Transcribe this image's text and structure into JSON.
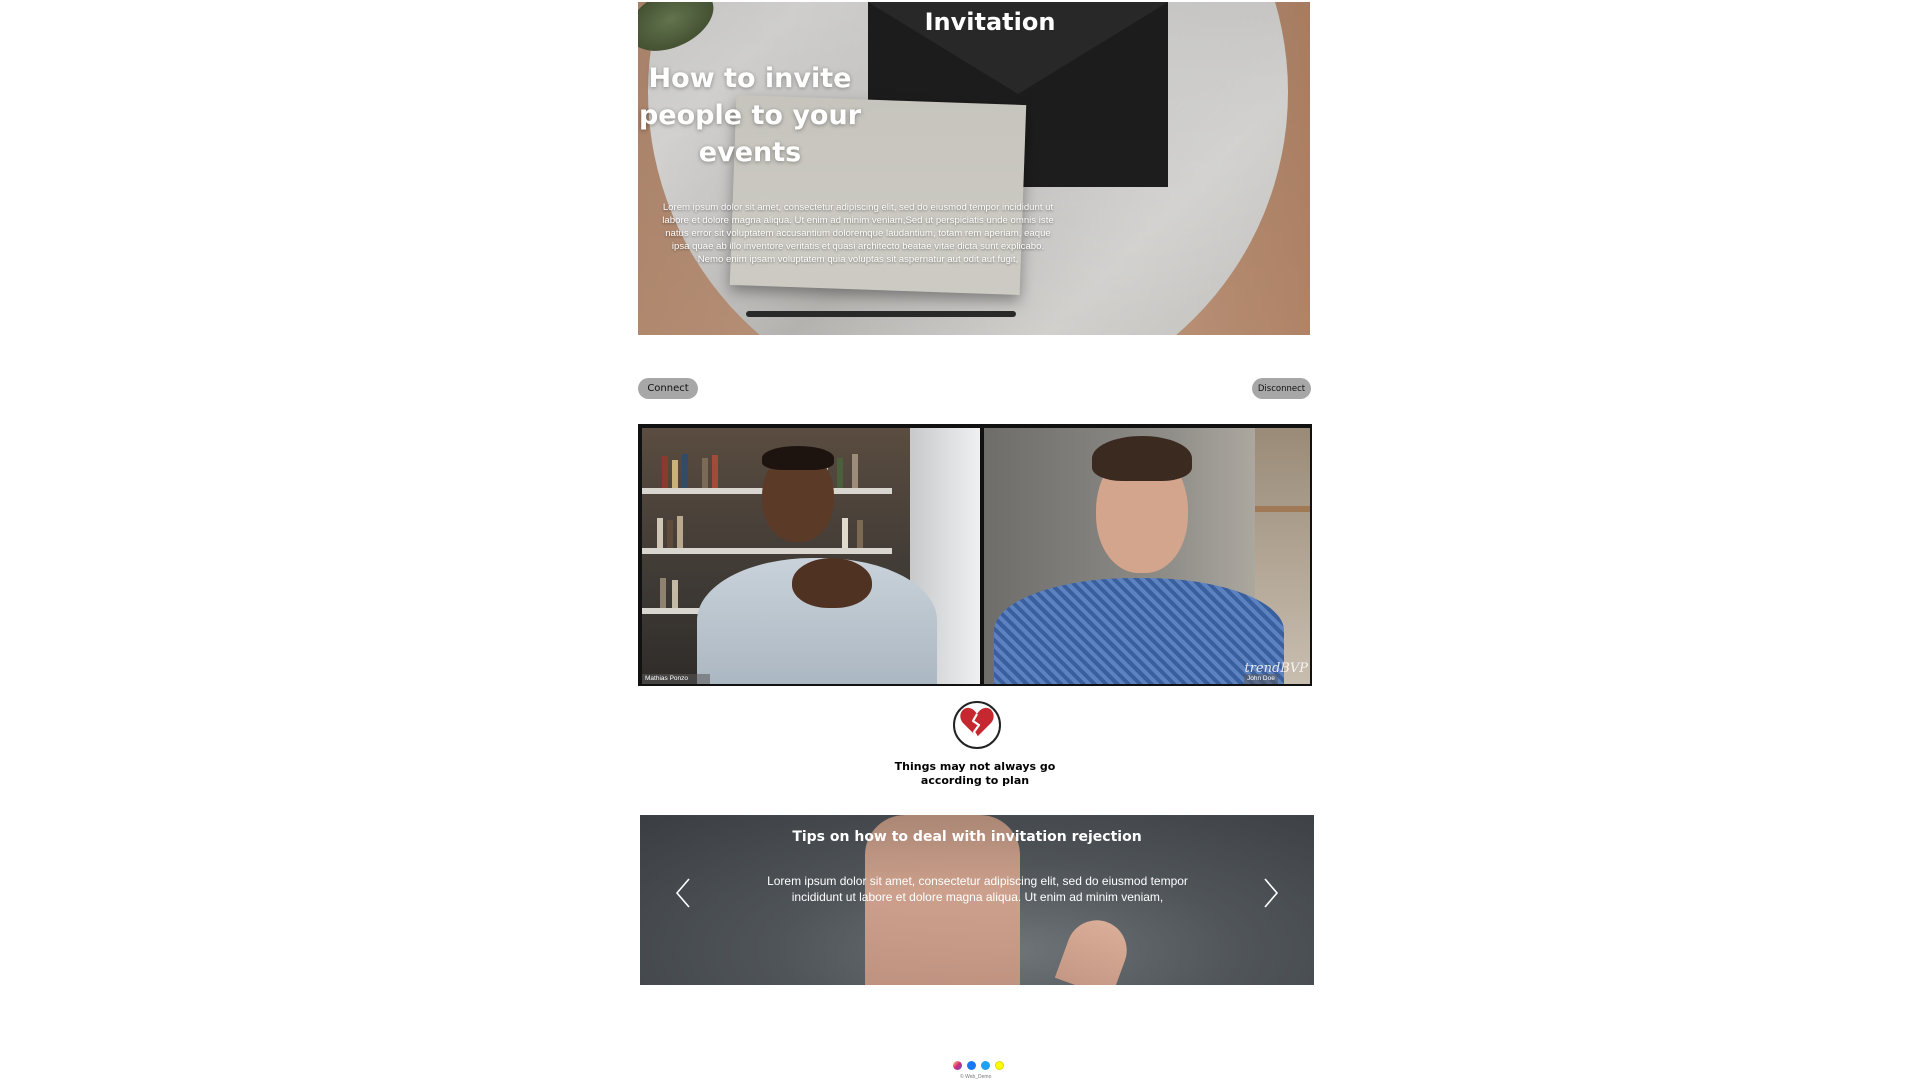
{
  "hero": {
    "header": "Invitation",
    "title": "How to invite people to your events",
    "body": "Lorem ipsum dolor sit amet, consectetur adipiscing elit, sed do eiusmod tempor incididunt ut labore et dolore magna aliqua. Ut enim ad minim veniam,Sed ut perspiciatis unde omnis iste natus error sit voluptatem accusantium doloremque laudantium, totam rem aperiam, eaque ipsa quae ab illo inventore veritatis et quasi architecto beatae vitae dicta sunt explicabo. Nemo enim ipsam voluptatem quia voluptas sit aspernatur aut odit aut fugit,"
  },
  "controls": {
    "connect_label": "Connect",
    "disconnect_label": "Disconnect"
  },
  "video": {
    "participants": [
      {
        "name": "Mathias Ponzo"
      },
      {
        "name": "John Doe"
      }
    ],
    "watermark": "trendBVP"
  },
  "notice": {
    "icon": "broken-heart-icon",
    "text": "Things may not always go according to plan"
  },
  "carousel": {
    "title": "Tips on how to deal with invitation rejection",
    "body": "Lorem ipsum dolor sit amet, consectetur adipiscing elit, sed do eiusmod tempor incididunt ut labore et dolore magna aliqua. Ut enim ad minim veniam,"
  },
  "footer": {
    "socials": [
      "instagram-icon",
      "facebook-icon",
      "twitter-icon",
      "snapchat-icon"
    ],
    "credit": "© Web_Demo"
  },
  "colors": {
    "button_bg": "#a7a7a7",
    "heart_red": "#c6282f",
    "carousel_bg": "#4f5458"
  }
}
